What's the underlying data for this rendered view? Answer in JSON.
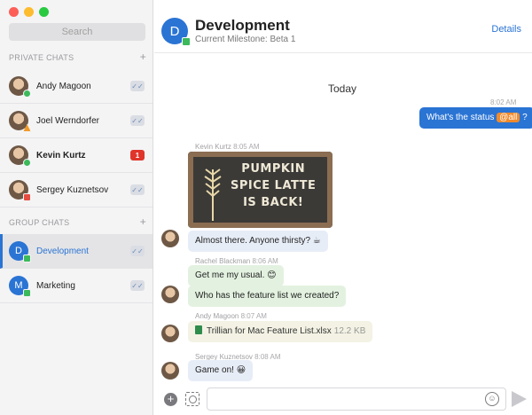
{
  "search": {
    "placeholder": "Search"
  },
  "sidebar": {
    "private_header": "PRIVATE CHATS",
    "group_header": "GROUP CHATS",
    "add_symbol": "+",
    "private_chats": [
      {
        "name": "Andy Magoon",
        "status": "online"
      },
      {
        "name": "Joel Werndorfer",
        "status": "away"
      },
      {
        "name": "Kevin Kurtz",
        "status": "online",
        "unread": "1"
      },
      {
        "name": "Sergey Kuznetsov",
        "status": "busy"
      }
    ],
    "group_chats": [
      {
        "name": "Development",
        "initial": "D",
        "active": true
      },
      {
        "name": "Marketing",
        "initial": "M",
        "active": false
      }
    ],
    "read_mark": "✓✓"
  },
  "header": {
    "initial": "D",
    "title": "Development",
    "subtitle": "Current Milestone: Beta 1",
    "details": "Details"
  },
  "conversation": {
    "day": "Today",
    "outgoing": {
      "time": "8:02 AM",
      "text": "What's the status ",
      "mention": "@all",
      "suffix": " ?"
    },
    "kevin": {
      "name": "Kevin Kurtz",
      "time": "8:05 AM",
      "image_text": [
        "PUMPKIN",
        "SPICE LATTE",
        "IS BACK!"
      ],
      "text": "Almost there. Anyone thirsty?",
      "emoji": "☕"
    },
    "rachel": {
      "name": "Rachel Blackman",
      "time": "8:06 AM",
      "text1": "Get me my usual.",
      "emoji1": "😊",
      "text2": "Who has the feature list we created?"
    },
    "andy": {
      "name": "Andy Magoon",
      "time": "8:07 AM",
      "file": "Trillian for Mac Feature List.xlsx",
      "size": "12.2 KB"
    },
    "sergey": {
      "name": "Sergey Kuznetsov",
      "time": "8:08 AM",
      "text": "Game on!",
      "emoji": "😀"
    }
  },
  "composer": {
    "plus": "+",
    "emoji": "☺",
    "placeholder": ""
  },
  "colors": {
    "accent": "#2a74d4",
    "mention": "#f08a2c",
    "unread": "#e0352b",
    "online": "#3cb95b"
  }
}
